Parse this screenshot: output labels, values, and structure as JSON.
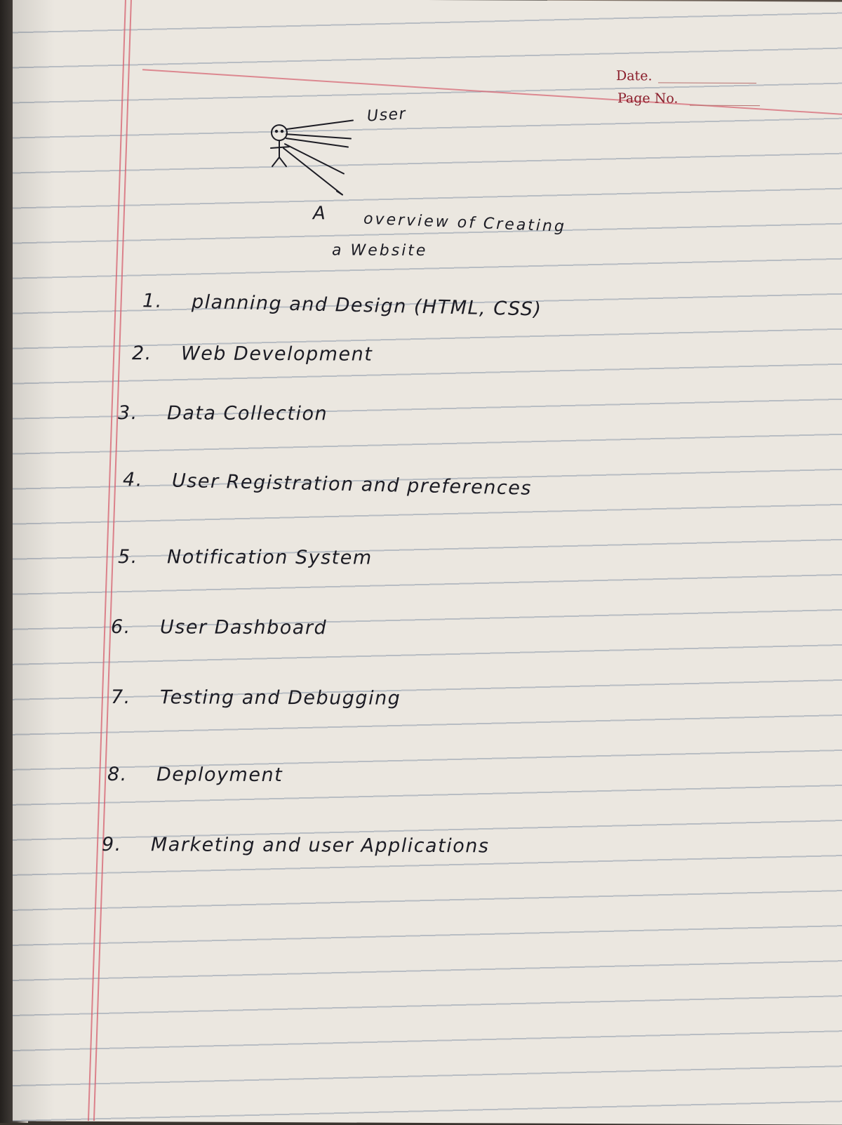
{
  "header": {
    "date_label": "Date.",
    "page_no_label": "Page No."
  },
  "sketch": {
    "user_label": "User",
    "icon": "stick-figure-icon"
  },
  "title": {
    "article": "A",
    "line1": "overview of Creating",
    "line2": "a Website"
  },
  "items": [
    {
      "num": "1.",
      "text": "planning and Design (HTML, CSS)"
    },
    {
      "num": "2.",
      "text": "Web Development"
    },
    {
      "num": "3.",
      "text": "Data Collection"
    },
    {
      "num": "4.",
      "text": "User Registration and preferences"
    },
    {
      "num": "5.",
      "text": "Notification System"
    },
    {
      "num": "6.",
      "text": "User Dashboard"
    },
    {
      "num": "7.",
      "text": "Testing and Debugging"
    },
    {
      "num": "8.",
      "text": "Deployment"
    },
    {
      "num": "9.",
      "text": "Marketing and user Applications"
    }
  ],
  "colors": {
    "ink": "#1c1c24",
    "header_text": "#8b1f2c",
    "margin_line": "#d65f6e",
    "paper": "#ebe7e0"
  }
}
